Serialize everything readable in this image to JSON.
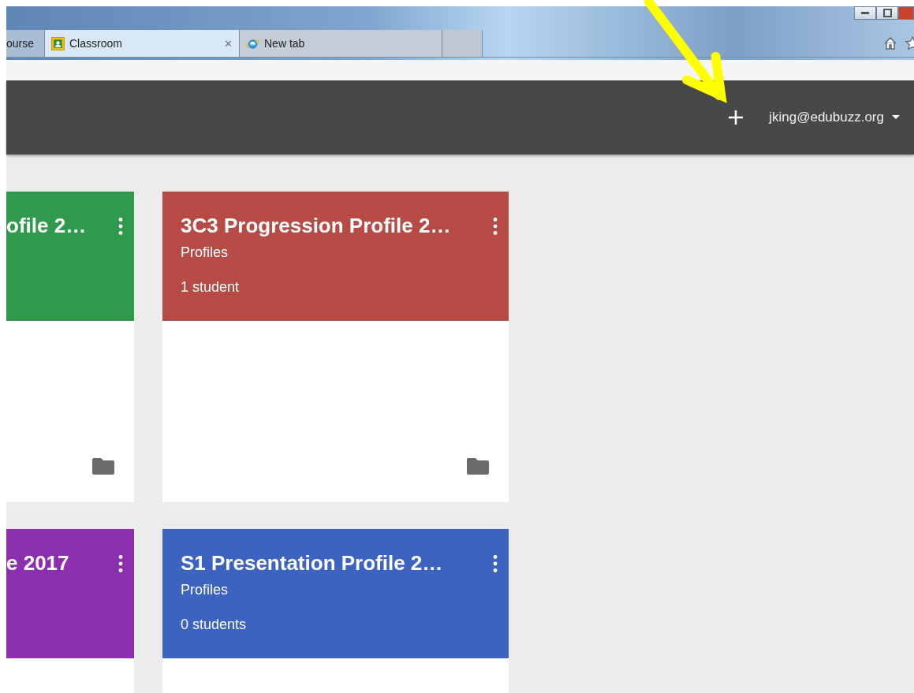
{
  "browser": {
    "tabs": [
      {
        "label": "ourse",
        "selected": false
      },
      {
        "label": "Classroom",
        "selected": true,
        "close": "✕"
      },
      {
        "label": "New tab",
        "selected": false
      },
      {
        "selected": false
      }
    ]
  },
  "header": {
    "account": "jking@edubuzz.org"
  },
  "rows": [
    [
      {
        "title": "ofile 2…",
        "color": "#2f9a4c"
      },
      {
        "title": "3C3 Progression Profile 2…",
        "color": "#b64b46",
        "subtitle": "Profiles",
        "students": "1 student"
      }
    ],
    [
      {
        "title": "e 2017",
        "color": "#8b2fae"
      },
      {
        "title": "S1 Presentation Profile 2…",
        "color": "#3b63bf",
        "subtitle": "Profiles",
        "students": "0 students"
      }
    ]
  ]
}
